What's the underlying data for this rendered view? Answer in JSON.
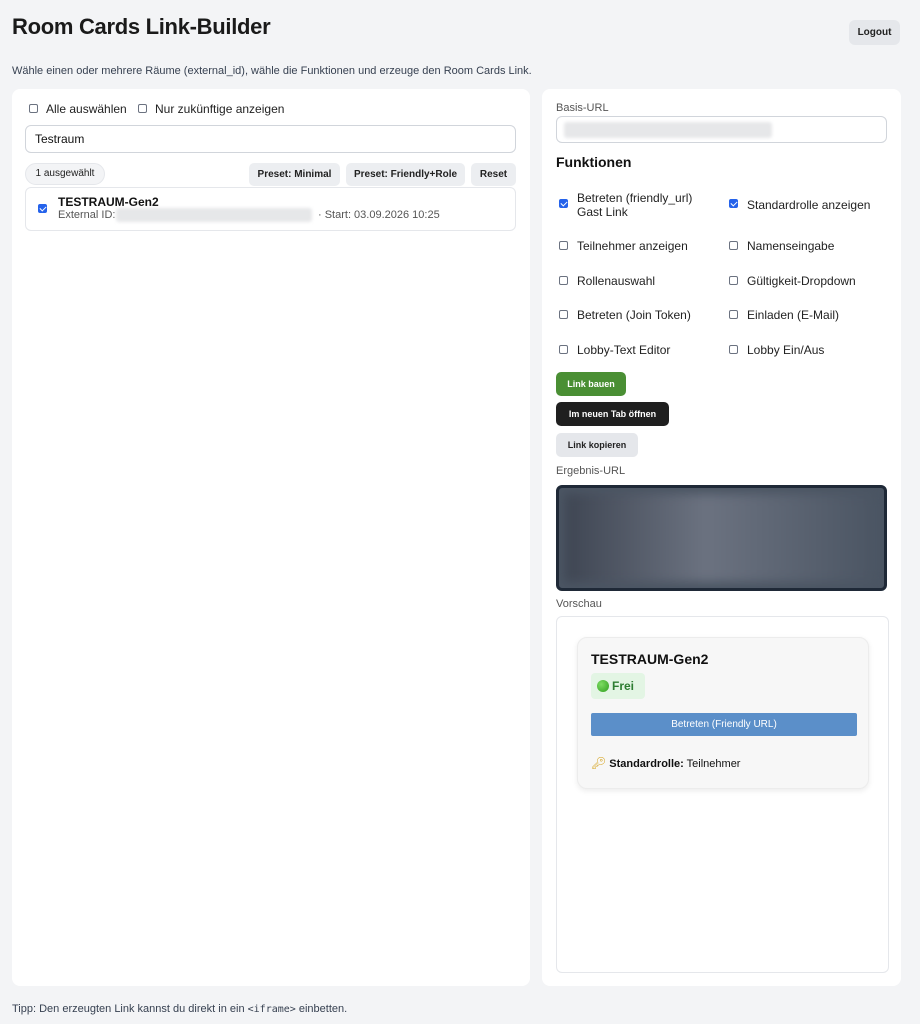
{
  "header": {
    "title": "Room Cards Link-Builder",
    "logout_label": "Logout",
    "subtitle": "Wähle einen oder mehrere Räume (external_id), wähle die Funktionen und erzeuge den Room Cards Link."
  },
  "left": {
    "select_all_label": "Alle auswählen",
    "future_only_label": "Nur zukünftige anzeigen",
    "search_value": "Testraum",
    "selected_count": "1 ausgewählt",
    "preset_minimal": "Preset: Minimal",
    "preset_friendly_role": "Preset: Friendly+Role",
    "reset_label": "Reset",
    "rooms": [
      {
        "name": "TESTRAUM-Gen2",
        "external_id_label": "External ID:",
        "start_text": "· Start: 03.09.2026 10:25",
        "checked": true
      }
    ]
  },
  "right": {
    "base_url_label": "Basis-URL",
    "functions_title": "Funktionen",
    "functions": [
      {
        "label": "Betreten (friendly_url)",
        "label2": "Gast Link",
        "checked": true
      },
      {
        "label": "Standardrolle anzeigen",
        "checked": true
      },
      {
        "label": "Teilnehmer anzeigen",
        "checked": false
      },
      {
        "label": "Namenseingabe",
        "checked": false
      },
      {
        "label": "Rollenauswahl",
        "checked": false
      },
      {
        "label": "Gültigkeit-Dropdown",
        "checked": false
      },
      {
        "label": "Betreten (Join Token)",
        "checked": false
      },
      {
        "label": "Einladen (E-Mail)",
        "checked": false
      },
      {
        "label": "Lobby-Text Editor",
        "checked": false
      },
      {
        "label": "Lobby Ein/Aus",
        "checked": false
      }
    ],
    "build_link_label": "Link bauen",
    "open_new_tab_label": "Im neuen Tab öffnen",
    "copy_link_label": "Link kopieren",
    "result_url_label": "Ergebnis-URL",
    "preview_label": "Vorschau",
    "preview_card": {
      "title": "TESTRAUM-Gen2",
      "status": "Frei",
      "join_button": "Betreten (Friendly URL)",
      "role_label": "Standardrolle:",
      "role_value": "Teilnehmer"
    }
  },
  "footer": {
    "tip_before": "Tipp: Den erzeugten Link kannst du direkt in ein",
    "tip_code": "<iframe>",
    "tip_after": "einbetten."
  },
  "colors": {
    "page_bg": "#f3f4f6",
    "green_button": "#4a8f34",
    "dark_button": "#1f1f1f",
    "join_button": "#5b8fc9",
    "checkbox_checked": "#2563eb"
  }
}
